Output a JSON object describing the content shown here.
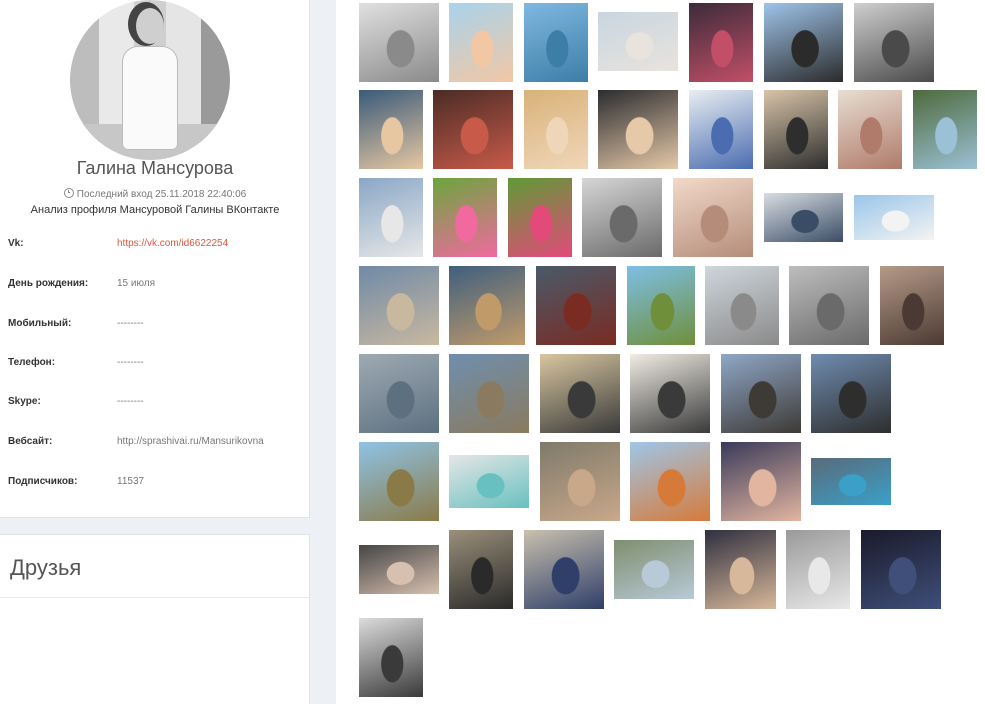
{
  "profile": {
    "name": "Галина Мансурова",
    "last_seen": "Последний вход 25.11.2018 22:40:06",
    "analysis_caption": "Анализ профиля Мансуровой Галины ВКонтакте",
    "icons": {
      "last_seen": "clock-icon"
    },
    "fields": [
      {
        "label": "Vk:",
        "value": "https://vk.com/id6622254",
        "is_link": true
      },
      {
        "label": "День рождения:",
        "value": "15 июля",
        "is_link": false
      },
      {
        "label": "Мобильный:",
        "value": "--------",
        "is_link": false
      },
      {
        "label": "Телефон:",
        "value": "--------",
        "is_link": false
      },
      {
        "label": "Skype:",
        "value": "--------",
        "is_link": false
      },
      {
        "label": "Вебсайт:",
        "value": "http://sprashivai.ru/Mansurikovna",
        "is_link": false
      },
      {
        "label": "Подписчиков:",
        "value": "11537",
        "is_link": false
      }
    ]
  },
  "friends": {
    "title": "Друзья"
  },
  "photos": {
    "count": 50,
    "colors": {
      "link": "#d9583b",
      "background": "#edf0f5"
    }
  }
}
